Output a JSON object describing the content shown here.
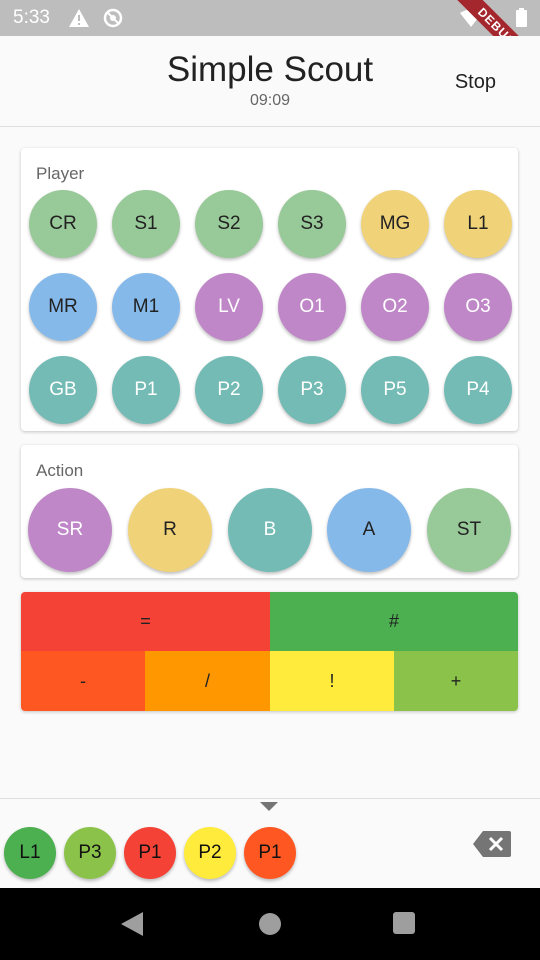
{
  "status_bar": {
    "time": "5:33",
    "debug_label": "DEBUG"
  },
  "app_bar": {
    "title": "Simple Scout",
    "subtitle": "09:09",
    "stop_label": "Stop"
  },
  "player_card": {
    "label": "Player",
    "rows": [
      [
        {
          "label": "CR",
          "color": "green"
        },
        {
          "label": "S1",
          "color": "green"
        },
        {
          "label": "S2",
          "color": "green"
        },
        {
          "label": "S3",
          "color": "green"
        },
        {
          "label": "MG",
          "color": "yellow"
        },
        {
          "label": "L1",
          "color": "yellow"
        }
      ],
      [
        {
          "label": "MR",
          "color": "blue"
        },
        {
          "label": "M1",
          "color": "blue"
        },
        {
          "label": "LV",
          "color": "purple"
        },
        {
          "label": "O1",
          "color": "purple"
        },
        {
          "label": "O2",
          "color": "purple"
        },
        {
          "label": "O3",
          "color": "purple"
        }
      ],
      [
        {
          "label": "GB",
          "color": "teal"
        },
        {
          "label": "P1",
          "color": "teal"
        },
        {
          "label": "P2",
          "color": "teal"
        },
        {
          "label": "P3",
          "color": "teal"
        },
        {
          "label": "P5",
          "color": "teal"
        },
        {
          "label": "P4",
          "color": "teal"
        }
      ]
    ]
  },
  "action_card": {
    "label": "Action",
    "items": [
      {
        "label": "SR",
        "color": "purple"
      },
      {
        "label": "R",
        "color": "yellow"
      },
      {
        "label": "B",
        "color": "teal"
      },
      {
        "label": "A",
        "color": "blue"
      },
      {
        "label": "ST",
        "color": "green"
      }
    ]
  },
  "rating": {
    "top": [
      {
        "label": "=",
        "color": "#f44336"
      },
      {
        "label": "#",
        "color": "#4caf50"
      }
    ],
    "bottom": [
      {
        "label": "-",
        "color": "#ff5722"
      },
      {
        "label": "/",
        "color": "#ff9800"
      },
      {
        "label": "!",
        "color": "#ffeb3b"
      },
      {
        "label": "+",
        "color": "#8bc34a"
      }
    ]
  },
  "history": [
    {
      "label": "L1",
      "color": "#4caf50"
    },
    {
      "label": "P3",
      "color": "#8bc34a"
    },
    {
      "label": "P1",
      "color": "#f44336"
    },
    {
      "label": "P2",
      "color": "#ffeb3b"
    },
    {
      "label": "P1",
      "color": "#ff5722"
    }
  ]
}
